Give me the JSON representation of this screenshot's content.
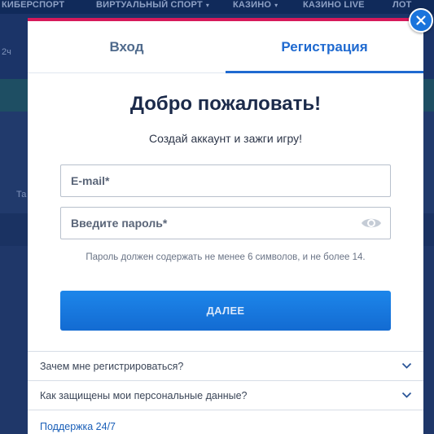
{
  "site": {
    "nav": [
      {
        "label": "КИБЕРСПОРТ",
        "caret": false
      },
      {
        "label": "ВИРТУАЛЬНЫЙ СПОРТ",
        "caret": true
      },
      {
        "label": "КАЗИНО",
        "caret": true
      },
      {
        "label": "КАЗИНО LIVE",
        "caret": false
      },
      {
        "label": "ЛОТ",
        "caret": false
      }
    ],
    "bg_small_1": "2ч",
    "bg_small_2": "Та"
  },
  "modal": {
    "accent_color": "#d6195a",
    "tabs": {
      "login_label": "Вход",
      "register_label": "Регистрация",
      "active": "register"
    },
    "title": "Добро пожаловать!",
    "subtitle": "Создай аккаунт и зажги игру!",
    "email": {
      "placeholder": "E-mail*",
      "value": ""
    },
    "password": {
      "placeholder": "Введите пароль*",
      "value": ""
    },
    "password_hint": "Пароль должен содержать не менее 6 символов, и не более 14.",
    "next_label": "ДАЛЕЕ",
    "faq": [
      {
        "label": "Зачем мне регистрироваться?"
      },
      {
        "label": "Как защищены мои персональные данные?"
      }
    ],
    "support_label": "Поддержка 24/7"
  },
  "icons": {
    "close": "close-icon",
    "eye": "eye-icon",
    "chevron": "chevron-down-icon"
  }
}
